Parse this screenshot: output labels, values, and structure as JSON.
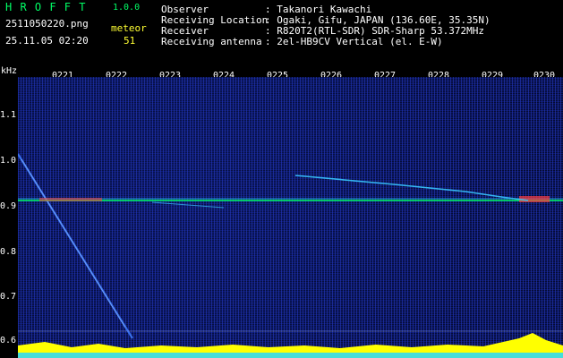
{
  "app": {
    "title": "H R O F F T",
    "version": "1.0.0",
    "filename": "2511050220.png",
    "meteor_label": "meteor",
    "datetime": "25.11.05 02:20",
    "meteor_count": "51"
  },
  "info": {
    "observer_label": "Observer",
    "observer_value": ": Takanori Kawachi",
    "location_label": "Receiving Location",
    "location_value": ": Ogaki, Gifu, JAPAN (136.60E, 35.35N)",
    "receiver_label": "Receiver",
    "receiver_value": ": R820T2(RTL-SDR) SDR-Sharp 53.372MHz",
    "antenna_label": "Receiving antenna",
    "antenna_value": ": 2el-HB9CV Vertical (el. E-W)"
  },
  "axis": {
    "y_unit": "kHz",
    "x_ticks": [
      "0221",
      "0222",
      "0223",
      "0224",
      "0225",
      "0226",
      "0227",
      "0228",
      "0229",
      "0230"
    ],
    "y_ticks": [
      "1.1",
      "1.0",
      "0.9",
      "0.8",
      "0.7",
      "0.6"
    ]
  },
  "colors": {
    "title_green": "#00ff66",
    "text_white": "#ffffff",
    "value_yellow": "#ffff33",
    "carrier_line": "#00ff66",
    "noise_yellow": "#ffff00"
  }
}
